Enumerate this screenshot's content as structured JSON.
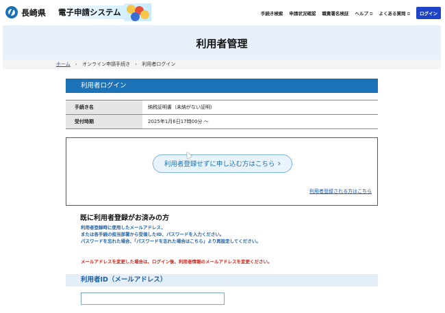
{
  "header": {
    "pref_name": "長崎県",
    "system_name": "電子申請システム",
    "nav": {
      "procedure_search": "手続き検索",
      "status_check": "申請状況確認",
      "signature_verify": "職責署名検証",
      "help": "ヘルプ",
      "faq": "よくある質問",
      "login": "ログイン"
    },
    "external_icon": "external-link-icon"
  },
  "page_title": "利用者管理",
  "breadcrumb": {
    "home": "ホーム",
    "separator": "›",
    "level1": "オンライン申請手続き",
    "level2": "利用者ログイン"
  },
  "login_section": {
    "header": "利用者ログイン",
    "rows": [
      {
        "label": "手続き名",
        "value": "納税証明書（未納がない証明）"
      },
      {
        "label": "受付時期",
        "value": "2025年1月6日17時00分 〜"
      }
    ]
  },
  "guest": {
    "button_label": "利用者登録せずに申し込む方はこちら",
    "chevron": "›",
    "register_link": "利用者登録される方はこちら"
  },
  "registered": {
    "title": "既に利用者登録がお済みの方",
    "desc_line1": "利用者登録時に使用したメールアドレス，",
    "desc_line2": "または各手続の担当部署から受領したID、パスワードを入力ください。",
    "desc_line3": "パスワードを忘れた場合、「パスワードを忘れた場合はこちら」より再設定してください。",
    "warning": "メールアドレスを変更した場合は、ログイン後、利用者情報のメールアドレスを変更ください。",
    "id_label": "利用者ID（メールアドレス）",
    "id_value": ""
  },
  "colors": {
    "primary_blue": "#1c73b8",
    "login_button": "#1e45c8",
    "title_band": "#e8f1fb",
    "warning_red": "#c8261c",
    "link_blue": "#1a55b0"
  }
}
